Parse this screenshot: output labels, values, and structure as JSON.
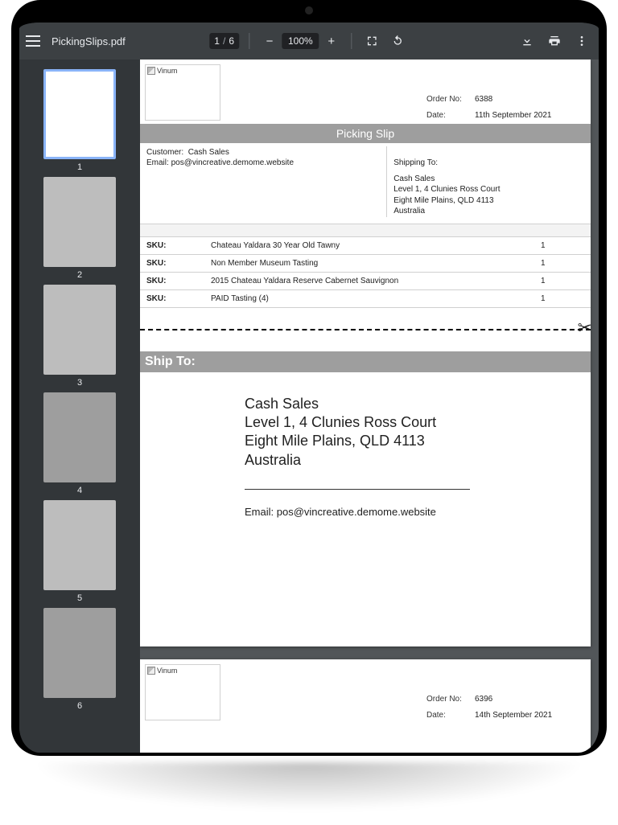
{
  "toolbar": {
    "filename": "PickingSlips.pdf",
    "page_current": "1",
    "page_total": "6",
    "zoom": "100%"
  },
  "thumbs": [
    "1",
    "2",
    "3",
    "4",
    "5",
    "6"
  ],
  "p1": {
    "logo_alt": "Vinum",
    "order_label": "Order No:",
    "order_value": "6388",
    "date_label": "Date:",
    "date_value": "11th September 2021",
    "title": "Picking Slip",
    "customer_label": "Customer:",
    "customer_value": "Cash Sales",
    "email_label": "Email:",
    "email_value": "pos@vincreative.demome.website",
    "shipping_to": "Shipping To:",
    "ship_name": "Cash Sales",
    "ship_addr1": "Level 1, 4 Clunies Ross Court",
    "ship_addr2": "Eight Mile Plains, QLD 4113",
    "ship_country": "Australia",
    "items": [
      {
        "sku": "SKU:",
        "name": "Chateau Yaldara 30 Year Old Tawny",
        "qty": "1"
      },
      {
        "sku": "SKU:",
        "name": "Non Member Museum Tasting",
        "qty": "1"
      },
      {
        "sku": "SKU:",
        "name": "2015 Chateau Yaldara Reserve Cabernet Sauvignon",
        "qty": "1"
      },
      {
        "sku": "SKU:",
        "name": "PAID Tasting (4)",
        "qty": "1"
      }
    ],
    "shipto_band": "Ship To:",
    "big_name": "Cash Sales",
    "big_addr1": "Level 1, 4 Clunies Ross Court",
    "big_addr2": "Eight Mile Plains, QLD 4113",
    "big_country": "Australia",
    "big_email": "Email: pos@vincreative.demome.website"
  },
  "p2": {
    "logo_alt": "Vinum",
    "order_label": "Order No:",
    "order_value": "6396",
    "date_label": "Date:",
    "date_value": "14th September 2021"
  }
}
